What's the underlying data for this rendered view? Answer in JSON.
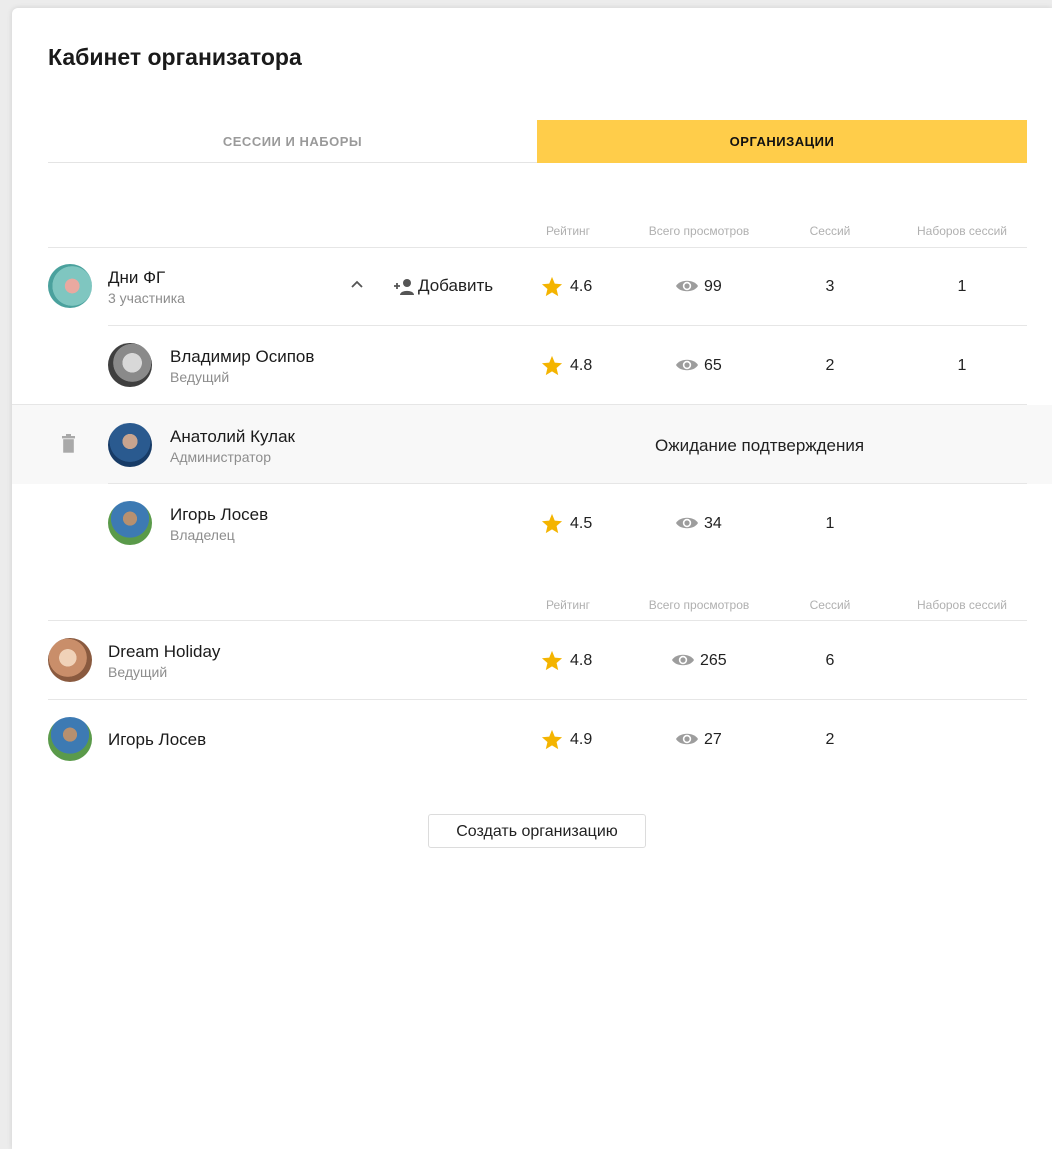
{
  "page": {
    "title": "Кабинет организатора"
  },
  "tabs": {
    "sessions": "СЕССИИ И НАБОРЫ",
    "orgs": "ОРГАНИЗАЦИИ",
    "active": "orgs"
  },
  "colors": {
    "accent": "#ffcd4a",
    "star": "#f4b400",
    "muted": "#8d8d8d"
  },
  "headers": {
    "rating": "Рейтинг",
    "views": "Всего просмотров",
    "sessions": "Сессий",
    "sets": "Наборов сессий"
  },
  "org1": {
    "name": "Дни ФГ",
    "sub": "3 участника",
    "add_label": "Добавить",
    "rating": "4.6",
    "views": "99",
    "sessions": "3",
    "sets": "1",
    "members": [
      {
        "name": "Владимир Осипов",
        "role": "Ведущий",
        "rating": "4.8",
        "views": "65",
        "sessions": "2",
        "sets": "1"
      },
      {
        "name": "Анатолий Кулак",
        "role": "Администратор",
        "status": "Ожидание подтверждения"
      },
      {
        "name": "Игорь Лосев",
        "role": "Владелец",
        "rating": "4.5",
        "views": "34",
        "sessions": "1"
      }
    ]
  },
  "orgs_list": [
    {
      "name": "Dream Holiday",
      "role": "Ведущий",
      "rating": "4.8",
      "views": "265",
      "sessions": "6"
    },
    {
      "name": "Игорь Лосев",
      "rating": "4.9",
      "views": "27",
      "sessions": "2"
    }
  ],
  "create_button": "Создать организацию",
  "icons": {
    "rating": "star-icon",
    "views": "eye-icon",
    "collapse": "chevron-up-icon",
    "add": "add-person-icon",
    "delete": "trash-icon"
  }
}
